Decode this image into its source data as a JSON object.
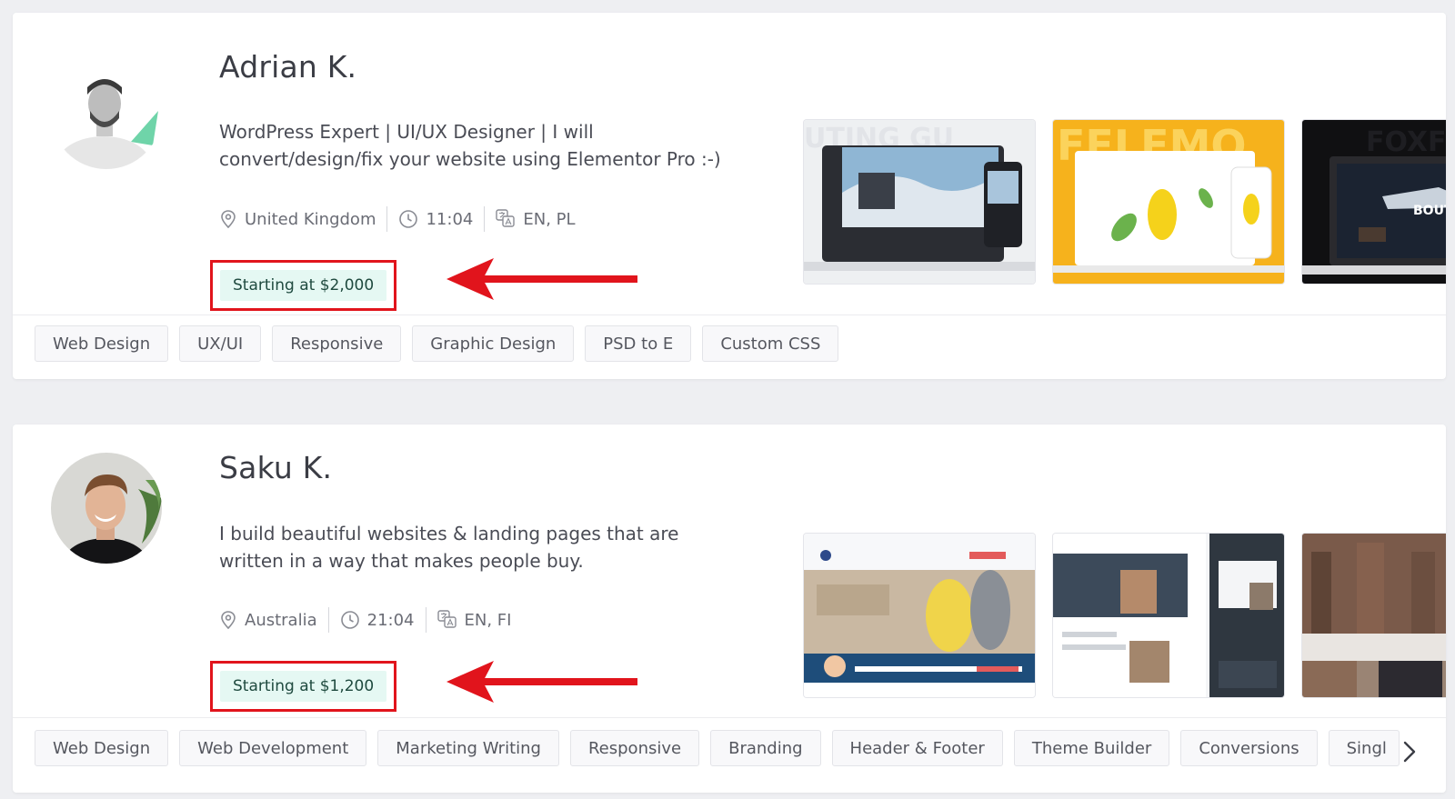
{
  "freelancers": [
    {
      "name": "Adrian K.",
      "headline": "WordPress Expert | UI/UX Designer | I will convert/design/fix your website using Elementor Pro :-)",
      "location": "United Kingdom",
      "time": "11:04",
      "languages": "EN, PL",
      "price": "Starting at $2,000",
      "skills": [
        "Web Design",
        "UX/UI",
        "Responsive",
        "Graphic Design",
        "PSD to E",
        "Custom CSS"
      ],
      "portfolio_texts": [
        "BOUT"
      ]
    },
    {
      "name": "Saku K.",
      "headline": "I build beautiful websites & landing pages that are written in a way that makes people buy.",
      "location": "Australia",
      "time": "21:04",
      "languages": "EN, FI",
      "price": "Starting at $1,200",
      "skills": [
        "Web Design",
        "Web Development",
        "Marketing Writing",
        "Responsive",
        "Branding",
        "Header & Footer",
        "Theme Builder",
        "Conversions",
        "Singl"
      ]
    }
  ],
  "icons": {
    "location": "location-pin-icon",
    "time": "clock-icon",
    "languages": "translate-icon",
    "next": "chevron-right-icon"
  },
  "colors": {
    "price_bg": "#e5f8f3",
    "price_text": "#1f4a3f",
    "annotation_red": "#e1141c"
  }
}
